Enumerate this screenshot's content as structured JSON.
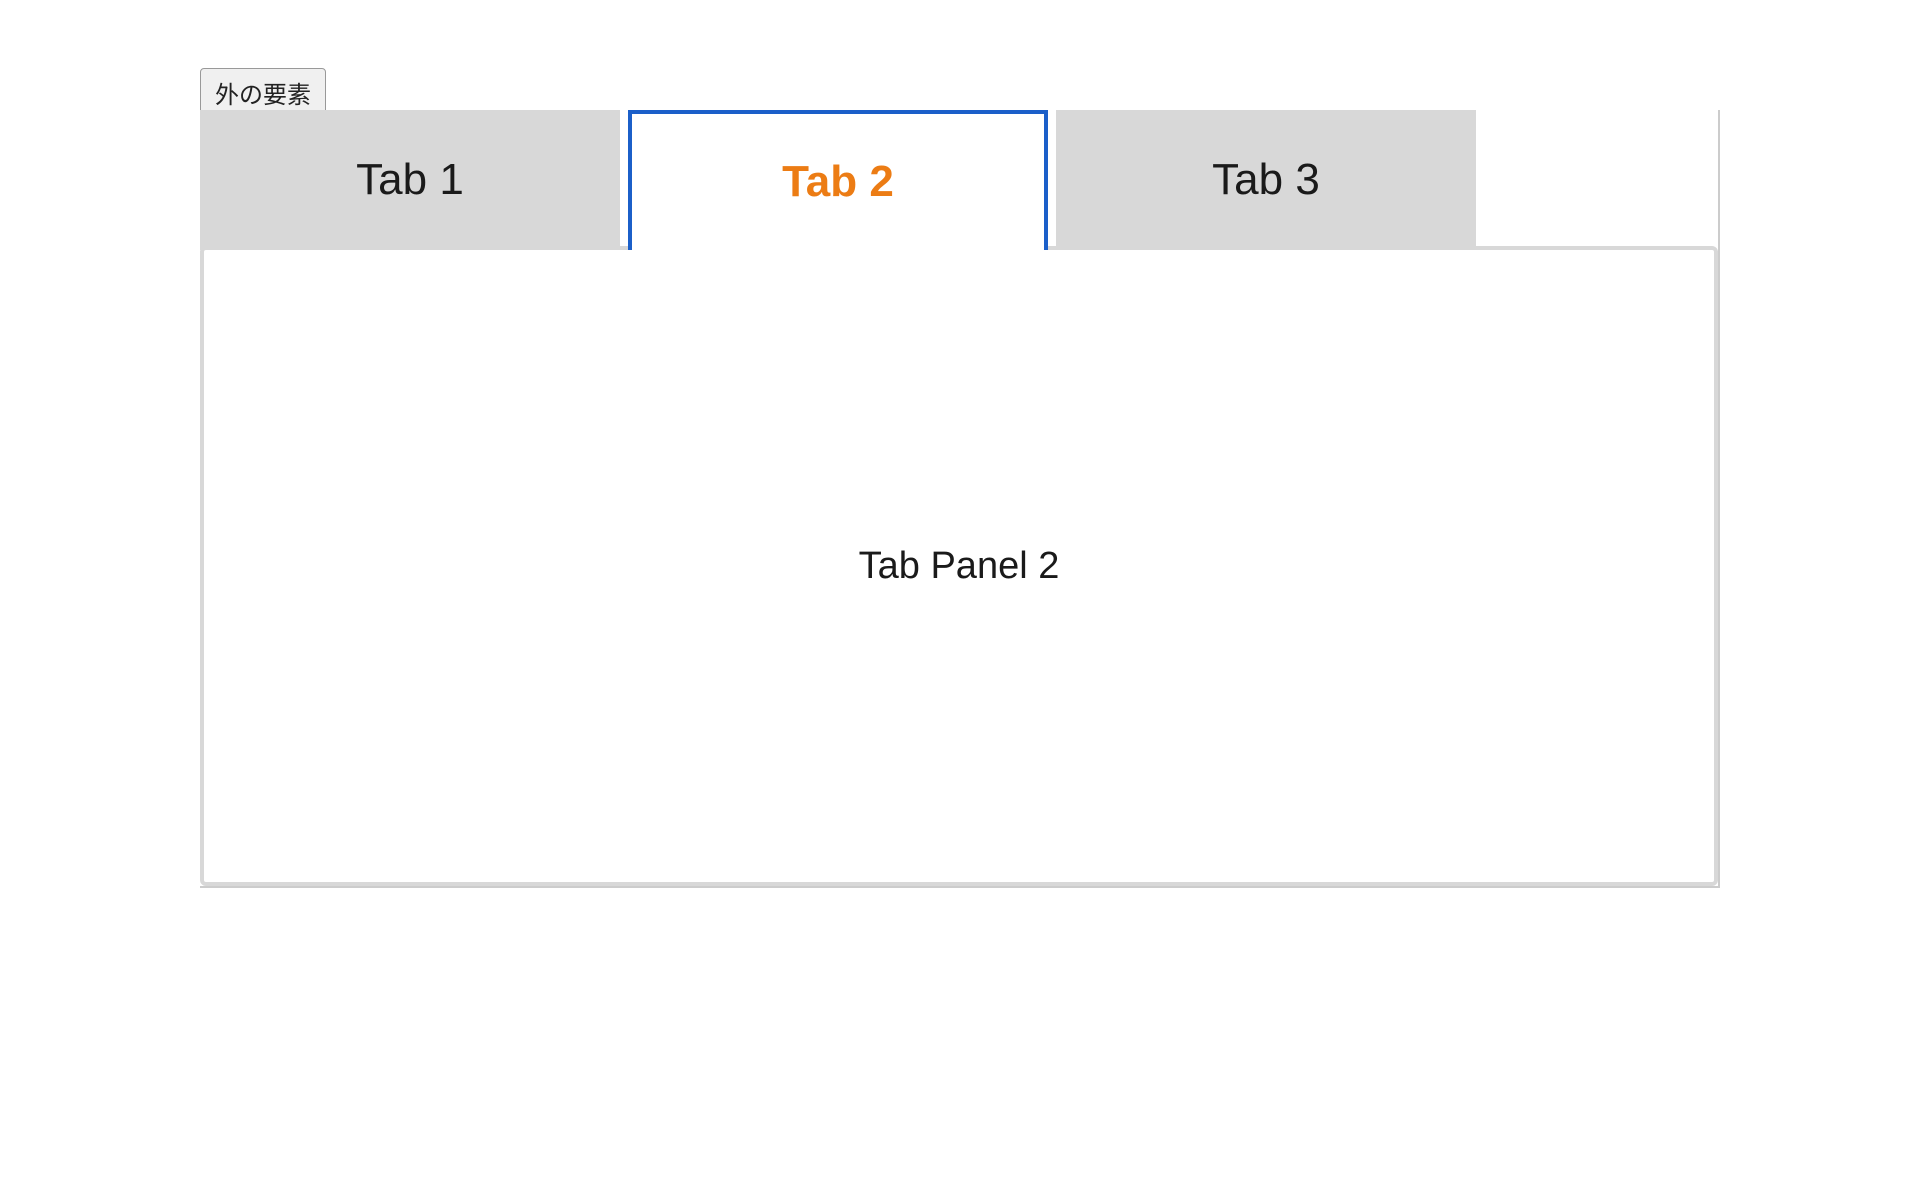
{
  "outside_button": {
    "label": "外の要素"
  },
  "tabs": [
    {
      "label": "Tab 1",
      "active": false
    },
    {
      "label": "Tab 2",
      "active": true
    },
    {
      "label": "Tab 3",
      "active": false
    }
  ],
  "panel": {
    "content": "Tab Panel 2"
  }
}
